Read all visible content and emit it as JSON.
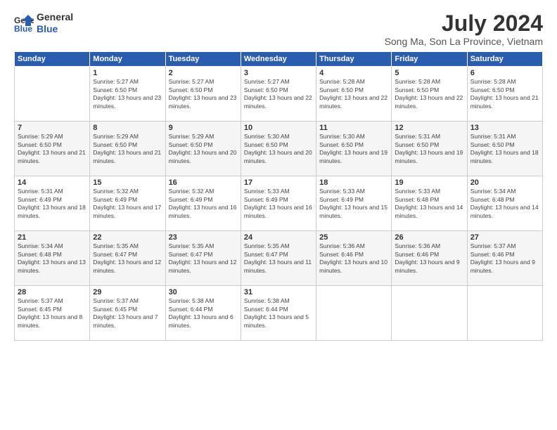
{
  "header": {
    "logo_line1": "General",
    "logo_line2": "Blue",
    "month_year": "July 2024",
    "location": "Song Ma, Son La Province, Vietnam"
  },
  "days_of_week": [
    "Sunday",
    "Monday",
    "Tuesday",
    "Wednesday",
    "Thursday",
    "Friday",
    "Saturday"
  ],
  "weeks": [
    [
      {
        "day": "",
        "sunrise": "",
        "sunset": "",
        "daylight": ""
      },
      {
        "day": "1",
        "sunrise": "Sunrise: 5:27 AM",
        "sunset": "Sunset: 6:50 PM",
        "daylight": "Daylight: 13 hours and 23 minutes."
      },
      {
        "day": "2",
        "sunrise": "Sunrise: 5:27 AM",
        "sunset": "Sunset: 6:50 PM",
        "daylight": "Daylight: 13 hours and 23 minutes."
      },
      {
        "day": "3",
        "sunrise": "Sunrise: 5:27 AM",
        "sunset": "Sunset: 6:50 PM",
        "daylight": "Daylight: 13 hours and 22 minutes."
      },
      {
        "day": "4",
        "sunrise": "Sunrise: 5:28 AM",
        "sunset": "Sunset: 6:50 PM",
        "daylight": "Daylight: 13 hours and 22 minutes."
      },
      {
        "day": "5",
        "sunrise": "Sunrise: 5:28 AM",
        "sunset": "Sunset: 6:50 PM",
        "daylight": "Daylight: 13 hours and 22 minutes."
      },
      {
        "day": "6",
        "sunrise": "Sunrise: 5:28 AM",
        "sunset": "Sunset: 6:50 PM",
        "daylight": "Daylight: 13 hours and 21 minutes."
      }
    ],
    [
      {
        "day": "7",
        "sunrise": "Sunrise: 5:29 AM",
        "sunset": "Sunset: 6:50 PM",
        "daylight": "Daylight: 13 hours and 21 minutes."
      },
      {
        "day": "8",
        "sunrise": "Sunrise: 5:29 AM",
        "sunset": "Sunset: 6:50 PM",
        "daylight": "Daylight: 13 hours and 21 minutes."
      },
      {
        "day": "9",
        "sunrise": "Sunrise: 5:29 AM",
        "sunset": "Sunset: 6:50 PM",
        "daylight": "Daylight: 13 hours and 20 minutes."
      },
      {
        "day": "10",
        "sunrise": "Sunrise: 5:30 AM",
        "sunset": "Sunset: 6:50 PM",
        "daylight": "Daylight: 13 hours and 20 minutes."
      },
      {
        "day": "11",
        "sunrise": "Sunrise: 5:30 AM",
        "sunset": "Sunset: 6:50 PM",
        "daylight": "Daylight: 13 hours and 19 minutes."
      },
      {
        "day": "12",
        "sunrise": "Sunrise: 5:31 AM",
        "sunset": "Sunset: 6:50 PM",
        "daylight": "Daylight: 13 hours and 19 minutes."
      },
      {
        "day": "13",
        "sunrise": "Sunrise: 5:31 AM",
        "sunset": "Sunset: 6:50 PM",
        "daylight": "Daylight: 13 hours and 18 minutes."
      }
    ],
    [
      {
        "day": "14",
        "sunrise": "Sunrise: 5:31 AM",
        "sunset": "Sunset: 6:49 PM",
        "daylight": "Daylight: 13 hours and 18 minutes."
      },
      {
        "day": "15",
        "sunrise": "Sunrise: 5:32 AM",
        "sunset": "Sunset: 6:49 PM",
        "daylight": "Daylight: 13 hours and 17 minutes."
      },
      {
        "day": "16",
        "sunrise": "Sunrise: 5:32 AM",
        "sunset": "Sunset: 6:49 PM",
        "daylight": "Daylight: 13 hours and 16 minutes."
      },
      {
        "day": "17",
        "sunrise": "Sunrise: 5:33 AM",
        "sunset": "Sunset: 6:49 PM",
        "daylight": "Daylight: 13 hours and 16 minutes."
      },
      {
        "day": "18",
        "sunrise": "Sunrise: 5:33 AM",
        "sunset": "Sunset: 6:49 PM",
        "daylight": "Daylight: 13 hours and 15 minutes."
      },
      {
        "day": "19",
        "sunrise": "Sunrise: 5:33 AM",
        "sunset": "Sunset: 6:48 PM",
        "daylight": "Daylight: 13 hours and 14 minutes."
      },
      {
        "day": "20",
        "sunrise": "Sunrise: 5:34 AM",
        "sunset": "Sunset: 6:48 PM",
        "daylight": "Daylight: 13 hours and 14 minutes."
      }
    ],
    [
      {
        "day": "21",
        "sunrise": "Sunrise: 5:34 AM",
        "sunset": "Sunset: 6:48 PM",
        "daylight": "Daylight: 13 hours and 13 minutes."
      },
      {
        "day": "22",
        "sunrise": "Sunrise: 5:35 AM",
        "sunset": "Sunset: 6:47 PM",
        "daylight": "Daylight: 13 hours and 12 minutes."
      },
      {
        "day": "23",
        "sunrise": "Sunrise: 5:35 AM",
        "sunset": "Sunset: 6:47 PM",
        "daylight": "Daylight: 13 hours and 12 minutes."
      },
      {
        "day": "24",
        "sunrise": "Sunrise: 5:35 AM",
        "sunset": "Sunset: 6:47 PM",
        "daylight": "Daylight: 13 hours and 11 minutes."
      },
      {
        "day": "25",
        "sunrise": "Sunrise: 5:36 AM",
        "sunset": "Sunset: 6:46 PM",
        "daylight": "Daylight: 13 hours and 10 minutes."
      },
      {
        "day": "26",
        "sunrise": "Sunrise: 5:36 AM",
        "sunset": "Sunset: 6:46 PM",
        "daylight": "Daylight: 13 hours and 9 minutes."
      },
      {
        "day": "27",
        "sunrise": "Sunrise: 5:37 AM",
        "sunset": "Sunset: 6:46 PM",
        "daylight": "Daylight: 13 hours and 9 minutes."
      }
    ],
    [
      {
        "day": "28",
        "sunrise": "Sunrise: 5:37 AM",
        "sunset": "Sunset: 6:45 PM",
        "daylight": "Daylight: 13 hours and 8 minutes."
      },
      {
        "day": "29",
        "sunrise": "Sunrise: 5:37 AM",
        "sunset": "Sunset: 6:45 PM",
        "daylight": "Daylight: 13 hours and 7 minutes."
      },
      {
        "day": "30",
        "sunrise": "Sunrise: 5:38 AM",
        "sunset": "Sunset: 6:44 PM",
        "daylight": "Daylight: 13 hours and 6 minutes."
      },
      {
        "day": "31",
        "sunrise": "Sunrise: 5:38 AM",
        "sunset": "Sunset: 6:44 PM",
        "daylight": "Daylight: 13 hours and 5 minutes."
      },
      {
        "day": "",
        "sunrise": "",
        "sunset": "",
        "daylight": ""
      },
      {
        "day": "",
        "sunrise": "",
        "sunset": "",
        "daylight": ""
      },
      {
        "day": "",
        "sunrise": "",
        "sunset": "",
        "daylight": ""
      }
    ]
  ]
}
